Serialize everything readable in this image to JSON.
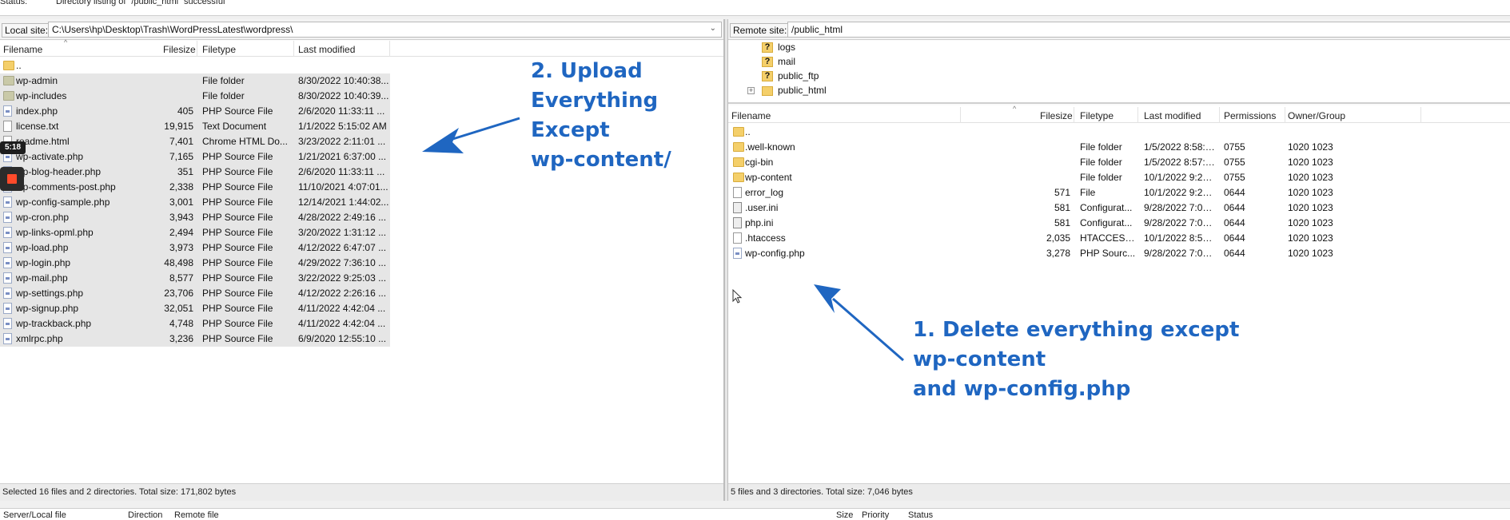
{
  "status_line": {
    "label": "Status:",
    "message": "Directory listing of \"/public_html\" successful"
  },
  "local": {
    "site_label": "Local site:",
    "path": "C:\\Users\\hp\\Desktop\\Trash\\WordPressLatest\\wordpress\\",
    "columns": [
      "Filename",
      "Filesize",
      "Filetype",
      "Last modified"
    ],
    "rows": [
      {
        "name": "..",
        "size": "",
        "type": "",
        "modified": "",
        "icon": "folder"
      },
      {
        "name": "wp-admin",
        "size": "",
        "type": "File folder",
        "modified": "8/30/2022 10:40:38...",
        "icon": "folder-gray"
      },
      {
        "name": "wp-includes",
        "size": "",
        "type": "File folder",
        "modified": "8/30/2022 10:40:39...",
        "icon": "folder-gray"
      },
      {
        "name": "index.php",
        "size": "405",
        "type": "PHP Source File",
        "modified": "2/6/2020 11:33:11 ...",
        "icon": "php"
      },
      {
        "name": "license.txt",
        "size": "19,915",
        "type": "Text Document",
        "modified": "1/1/2022 5:15:02 AM",
        "icon": "plain"
      },
      {
        "name": "readme.html",
        "size": "7,401",
        "type": "Chrome HTML Do...",
        "modified": "3/23/2022 2:11:01 ...",
        "icon": "plain"
      },
      {
        "name": "wp-activate.php",
        "size": "7,165",
        "type": "PHP Source File",
        "modified": "1/21/2021 6:37:00 ...",
        "icon": "php"
      },
      {
        "name": "wp-blog-header.php",
        "size": "351",
        "type": "PHP Source File",
        "modified": "2/6/2020 11:33:11 ...",
        "icon": "php"
      },
      {
        "name": "wp-comments-post.php",
        "size": "2,338",
        "type": "PHP Source File",
        "modified": "11/10/2021 4:07:01...",
        "icon": "php"
      },
      {
        "name": "wp-config-sample.php",
        "size": "3,001",
        "type": "PHP Source File",
        "modified": "12/14/2021 1:44:02...",
        "icon": "php"
      },
      {
        "name": "wp-cron.php",
        "size": "3,943",
        "type": "PHP Source File",
        "modified": "4/28/2022 2:49:16 ...",
        "icon": "php"
      },
      {
        "name": "wp-links-opml.php",
        "size": "2,494",
        "type": "PHP Source File",
        "modified": "3/20/2022 1:31:12 ...",
        "icon": "php"
      },
      {
        "name": "wp-load.php",
        "size": "3,973",
        "type": "PHP Source File",
        "modified": "4/12/2022 6:47:07 ...",
        "icon": "php"
      },
      {
        "name": "wp-login.php",
        "size": "48,498",
        "type": "PHP Source File",
        "modified": "4/29/2022 7:36:10 ...",
        "icon": "php"
      },
      {
        "name": "wp-mail.php",
        "size": "8,577",
        "type": "PHP Source File",
        "modified": "3/22/2022 9:25:03 ...",
        "icon": "php"
      },
      {
        "name": "wp-settings.php",
        "size": "23,706",
        "type": "PHP Source File",
        "modified": "4/12/2022 2:26:16 ...",
        "icon": "php"
      },
      {
        "name": "wp-signup.php",
        "size": "32,051",
        "type": "PHP Source File",
        "modified": "4/11/2022 4:42:04 ...",
        "icon": "php"
      },
      {
        "name": "wp-trackback.php",
        "size": "4,748",
        "type": "PHP Source File",
        "modified": "4/11/2022 4:42:04 ...",
        "icon": "php"
      },
      {
        "name": "xmlrpc.php",
        "size": "3,236",
        "type": "PHP Source File",
        "modified": "6/9/2020 12:55:10 ...",
        "icon": "php"
      }
    ],
    "status": "Selected 16 files and 2 directories. Total size: 171,802 bytes"
  },
  "remote": {
    "site_label": "Remote site:",
    "path": "/public_html",
    "tree": [
      {
        "name": "logs",
        "icon": "question"
      },
      {
        "name": "mail",
        "icon": "question"
      },
      {
        "name": "public_ftp",
        "icon": "question"
      },
      {
        "name": "public_html",
        "icon": "folder"
      }
    ],
    "columns": [
      "Filename",
      "Filesize",
      "Filetype",
      "Last modified",
      "Permissions",
      "Owner/Group"
    ],
    "rows": [
      {
        "name": "..",
        "size": "",
        "type": "",
        "modified": "",
        "perms": "",
        "owner": "",
        "icon": "folder"
      },
      {
        "name": ".well-known",
        "size": "",
        "type": "File folder",
        "modified": "1/5/2022 8:58:3...",
        "perms": "0755",
        "owner": "1020 1023",
        "icon": "folder"
      },
      {
        "name": "cgi-bin",
        "size": "",
        "type": "File folder",
        "modified": "1/5/2022 8:57:3...",
        "perms": "0755",
        "owner": "1020 1023",
        "icon": "folder"
      },
      {
        "name": "wp-content",
        "size": "",
        "type": "File folder",
        "modified": "10/1/2022 9:26:...",
        "perms": "0755",
        "owner": "1020 1023",
        "icon": "folder"
      },
      {
        "name": "error_log",
        "size": "571",
        "type": "File",
        "modified": "10/1/2022 9:26:...",
        "perms": "0644",
        "owner": "1020 1023",
        "icon": "plain"
      },
      {
        "name": ".user.ini",
        "size": "581",
        "type": "Configurat...",
        "modified": "9/28/2022 7:08:...",
        "perms": "0644",
        "owner": "1020 1023",
        "icon": "cfg"
      },
      {
        "name": "php.ini",
        "size": "581",
        "type": "Configurat...",
        "modified": "9/28/2022 7:08:...",
        "perms": "0644",
        "owner": "1020 1023",
        "icon": "cfg"
      },
      {
        "name": ".htaccess",
        "size": "2,035",
        "type": "HTACCESS ...",
        "modified": "10/1/2022 8:50:...",
        "perms": "0644",
        "owner": "1020 1023",
        "icon": "plain"
      },
      {
        "name": "wp-config.php",
        "size": "3,278",
        "type": "PHP Sourc...",
        "modified": "9/28/2022 7:09:...",
        "perms": "0644",
        "owner": "1020 1023",
        "icon": "php"
      }
    ],
    "status": "5 files and 3 directories. Total size: 7,046 bytes"
  },
  "queue": {
    "columns": [
      "Server/Local file",
      "Direction",
      "Remote file",
      "Size",
      "Priority",
      "Status"
    ]
  },
  "overlay": {
    "timer": "5:18"
  },
  "annotations": {
    "upload": [
      "2. Upload",
      "Everything",
      "Except",
      "wp-content/"
    ],
    "delete": [
      "1. Delete everything except",
      "wp-content",
      "and wp-config.php"
    ]
  },
  "colors": {
    "annotation": "#1f66c1",
    "selection": "#e6e6e6",
    "folder": "#f4cf6a"
  }
}
